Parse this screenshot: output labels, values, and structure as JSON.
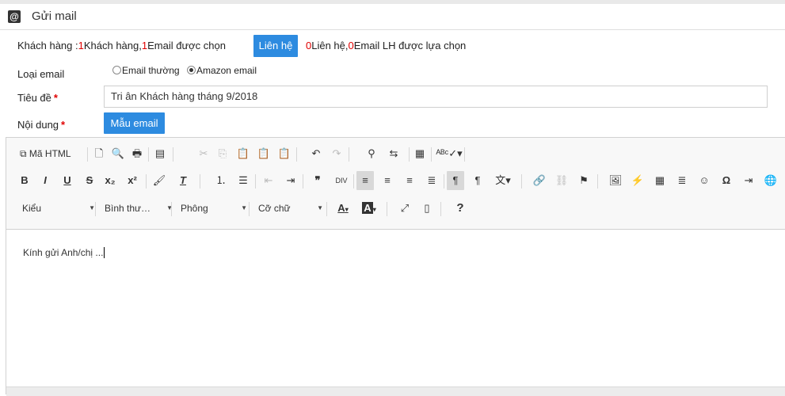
{
  "header": {
    "title": "Gửi mail",
    "icon": "at-icon"
  },
  "customers": {
    "prefix": "Khách hàng :",
    "count1": "1",
    "text1": "Khách hàng,",
    "count2": "1",
    "text2": "Email được chọn"
  },
  "contacts": {
    "button": "Liên hệ",
    "count1": "0",
    "text1": "Liên hệ,",
    "count2": "0",
    "text2": "Email LH được lựa chọn"
  },
  "email_type": {
    "label": "Loại email",
    "options": [
      "Email thường",
      "Amazon email"
    ],
    "selected": "Amazon email"
  },
  "subject": {
    "label": "Tiêu đề",
    "required_mark": "*",
    "value": "Tri ân Khách hàng tháng 9/2018"
  },
  "content": {
    "label": "Nội dung",
    "required_mark": "*",
    "template_button": "Mẫu email"
  },
  "editor": {
    "source_label": "Mã HTML",
    "combos": [
      "Kiểu",
      "Bình thư…",
      "Phông",
      "Cỡ chữ"
    ],
    "body_text": "Kính gửi Anh/chị ...",
    "glyphs": {
      "bold": "B",
      "italic": "I",
      "underline": "U",
      "strike": "S",
      "sub": "x₂",
      "sup": "x²",
      "clear": "T",
      "quote": "❞",
      "ltr": "¶",
      "rtl": "¶",
      "lang": "文",
      "omega": "Ω",
      "help": "?",
      "text_color": "A",
      "bg_color": "A"
    }
  }
}
